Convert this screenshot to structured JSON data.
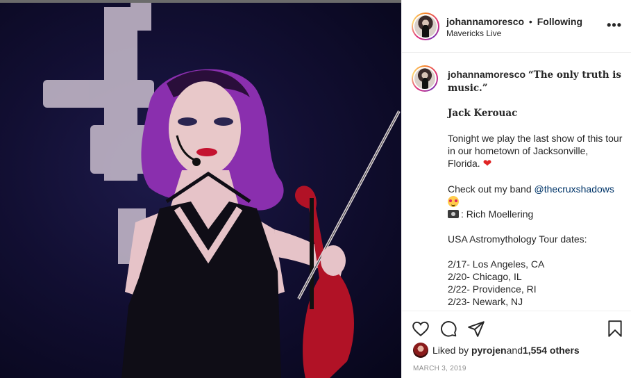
{
  "post": {
    "username": "johannamoresco",
    "separator": "•",
    "follow_status": "Following",
    "location": "Mavericks Live",
    "more_label": "•••"
  },
  "caption": {
    "username": "johannamoresco",
    "quote": "“The only truth is music.”",
    "author": "Jack Kerouac",
    "paragraph1": "Tonight we play the last show of this tour in our hometown of Jacksonville, Florida.",
    "heart": "❤",
    "band_prefix": "Check out my band ",
    "band_mention": "@thecruxshadows",
    "photo_credit": "Rich Moellering",
    "tour_heading": "USA Astromythology Tour dates:",
    "dates": [
      "2/17- Los Angeles, CA",
      "2/20- Chicago, IL",
      "2/22- Providence, RI",
      "2/23- Newark, NJ"
    ]
  },
  "actions": {
    "icons": [
      "heart-icon",
      "comment-icon",
      "share-icon",
      "bookmark-icon"
    ]
  },
  "likes": {
    "prefix": "Liked by ",
    "user": "pyrojen",
    "middle": " and ",
    "count": "1,554 others"
  },
  "date": "MARCH 3, 2019",
  "colors": {
    "mention": "#003569",
    "heart": "#e02424",
    "text": "#262626",
    "muted": "#8e8e8e",
    "border": "#efefef"
  }
}
